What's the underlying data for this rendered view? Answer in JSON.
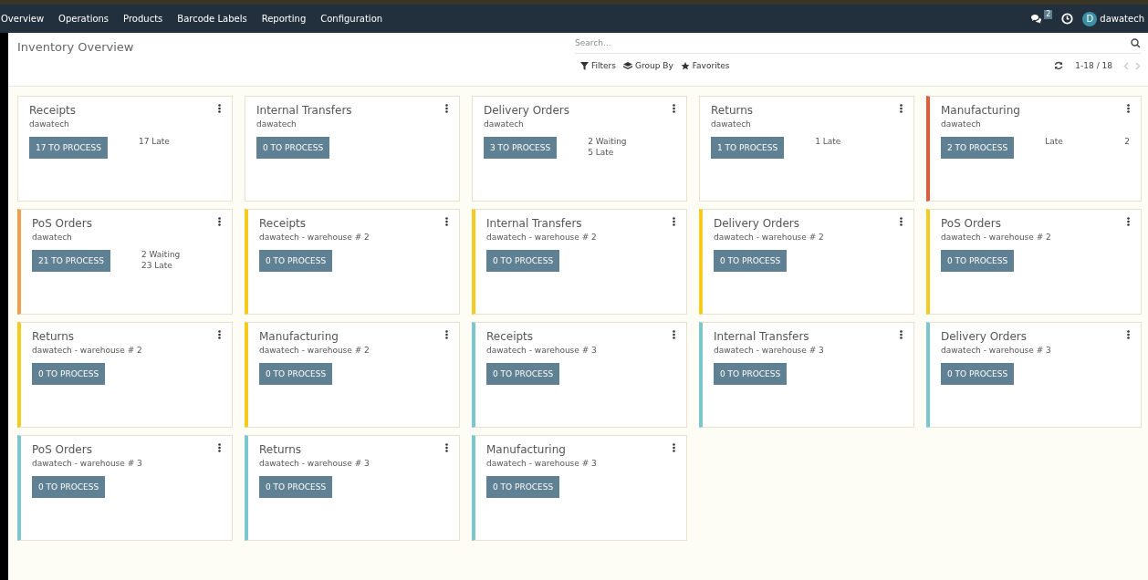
{
  "navbar": {
    "menu": [
      {
        "label": "Overview"
      },
      {
        "label": "Operations"
      },
      {
        "label": "Products"
      },
      {
        "label": "Barcode Labels"
      },
      {
        "label": "Reporting"
      },
      {
        "label": "Configuration"
      }
    ],
    "messages_count": "2",
    "avatar_letter": "D",
    "user": "dawatech"
  },
  "title": "Inventory Overview",
  "search": {
    "placeholder": "Search..."
  },
  "filters": [
    {
      "label": "Filters",
      "kind": "filter"
    },
    {
      "label": "Group By",
      "kind": "group"
    },
    {
      "label": "Favorites",
      "kind": "star"
    }
  ],
  "pager": "1-18 / 18",
  "cards": [
    {
      "title": "Receipts",
      "subtitle": "dawatech",
      "button": "17 TO PROCESS",
      "stats": [
        {
          "text": "17 Late"
        }
      ]
    },
    {
      "title": "Internal Transfers",
      "subtitle": "dawatech",
      "button": "0 TO PROCESS"
    },
    {
      "title": "Delivery Orders",
      "subtitle": "dawatech",
      "button": "3 TO PROCESS",
      "stats": [
        {
          "text": "2 Waiting"
        },
        {
          "text": "5 Late"
        }
      ]
    },
    {
      "title": "Returns",
      "subtitle": "dawatech",
      "button": "1 TO PROCESS",
      "stats": [
        {
          "text": "1 Late"
        }
      ]
    },
    {
      "title": "Manufacturing",
      "subtitle": "dawatech",
      "button": "2 TO PROCESS",
      "color": "#e4593a",
      "stats": [
        {
          "text": "Late",
          "value": "2"
        }
      ]
    },
    {
      "title": "PoS Orders",
      "subtitle": "dawatech",
      "button": "21 TO PROCESS",
      "color": "#f0a04b",
      "stats": [
        {
          "text": "2 Waiting"
        },
        {
          "text": "23 Late"
        }
      ]
    },
    {
      "title": "Receipts",
      "subtitle": "dawatech - warehouse # 2",
      "button": "0 TO PROCESS",
      "color": "#f5cb1e"
    },
    {
      "title": "Internal Transfers",
      "subtitle": "dawatech - warehouse # 2",
      "button": "0 TO PROCESS",
      "color": "#f5cb1e"
    },
    {
      "title": "Delivery Orders",
      "subtitle": "dawatech - warehouse # 2",
      "button": "0 TO PROCESS",
      "color": "#f5cb1e"
    },
    {
      "title": "PoS Orders",
      "subtitle": "dawatech - warehouse # 2",
      "button": "0 TO PROCESS",
      "color": "#f5cb1e"
    },
    {
      "title": "Returns",
      "subtitle": "dawatech - warehouse # 2",
      "button": "0 TO PROCESS",
      "color": "#f5cb1e"
    },
    {
      "title": "Manufacturing",
      "subtitle": "dawatech - warehouse # 2",
      "button": "0 TO PROCESS",
      "color": "#f5cb1e"
    },
    {
      "title": "Receipts",
      "subtitle": "dawatech - warehouse # 3",
      "button": "0 TO PROCESS",
      "color": "#7cc7cf"
    },
    {
      "title": "Internal Transfers",
      "subtitle": "dawatech - warehouse # 3",
      "button": "0 TO PROCESS",
      "color": "#7cc7cf"
    },
    {
      "title": "Delivery Orders",
      "subtitle": "dawatech - warehouse # 3",
      "button": "0 TO PROCESS",
      "color": "#7cc7cf"
    },
    {
      "title": "PoS Orders",
      "subtitle": "dawatech - warehouse # 3",
      "button": "0 TO PROCESS",
      "color": "#7cc7cf"
    },
    {
      "title": "Returns",
      "subtitle": "dawatech - warehouse # 3",
      "button": "0 TO PROCESS",
      "color": "#7cc7cf"
    },
    {
      "title": "Manufacturing",
      "subtitle": "dawatech - warehouse # 3",
      "button": "0 TO PROCESS",
      "color": "#7cc7cf"
    }
  ]
}
